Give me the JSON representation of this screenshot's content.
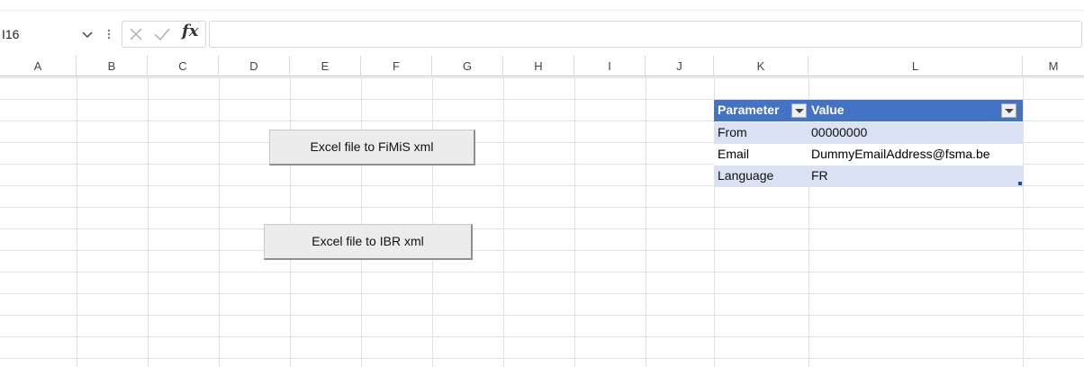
{
  "formula_bar": {
    "name_box": "I16",
    "fx_label": "fx",
    "formula_value": ""
  },
  "columns": [
    "A",
    "B",
    "C",
    "D",
    "E",
    "F",
    "G",
    "H",
    "I",
    "J",
    "K",
    "L",
    "M"
  ],
  "buttons": {
    "fimis": "Excel file to FiMiS xml",
    "ibr": "Excel file to IBR xml"
  },
  "param_table": {
    "headers": [
      "Parameter",
      "Value"
    ],
    "rows": [
      {
        "param": "From",
        "value": "00000000"
      },
      {
        "param": "Email",
        "value": "DummyEmailAddress@fsma.be"
      },
      {
        "param": "Language",
        "value": "FR"
      }
    ]
  },
  "colors": {
    "table_header": "#4472c4",
    "table_band": "#d9e1f2",
    "grid_line": "#e1e1e1"
  }
}
